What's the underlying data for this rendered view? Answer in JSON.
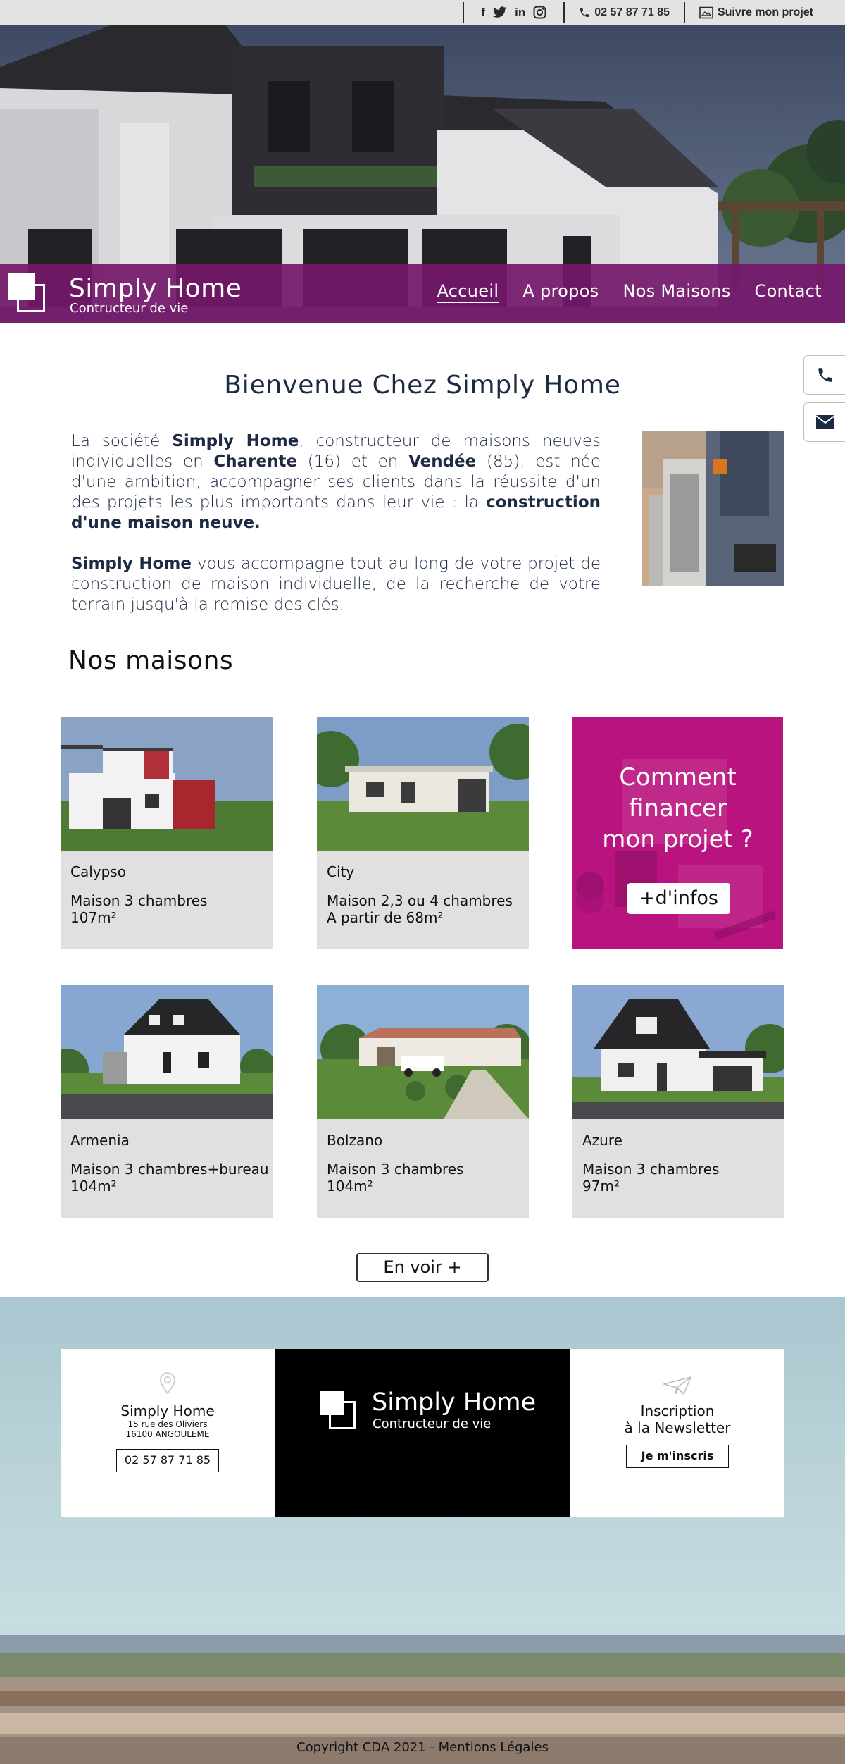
{
  "topbar": {
    "social": [
      {
        "label": "f",
        "icon": "facebook-icon"
      },
      {
        "label": "twitter",
        "icon": "twitter-icon"
      },
      {
        "label": "in",
        "icon": "linkedin-icon"
      },
      {
        "label": "instagram",
        "icon": "instagram-icon"
      }
    ],
    "phone": "02 57 87 71 85",
    "project_link": "Suivre mon projet"
  },
  "brand": {
    "name": "Simply Home",
    "tagline": "Contructeur de vie"
  },
  "nav": {
    "items": [
      "Accueil",
      "A propos",
      "Nos Maisons",
      "Contact"
    ],
    "active": "Accueil"
  },
  "side_buttons": {
    "phone_icon": "phone-icon",
    "mail_icon": "mail-icon"
  },
  "welcome": {
    "title": "Bienvenue Chez Simply Home",
    "p1": {
      "t1": "La société ",
      "b1": "Simply Home",
      "t2": ", constructeur de maisons neuves individuelles en ",
      "b2": "Charente",
      "t3": " (16) et en ",
      "b3": "Vendée",
      "t4": " (85), est née d'une ambition, accompagner ses clients dans la réussite d'un des projets les plus importants dans leur vie : la ",
      "b4": "construction d'une maison neuve."
    },
    "p2": {
      "b1": "Simply Home",
      "t1": " vous accompagne tout au long de votre projet de construction de maison individuelle, de la recherche de votre terrain jusqu'à la remise des clés."
    }
  },
  "houses": {
    "title": "Nos maisons",
    "cards": [
      {
        "name": "Calypso",
        "desc1": "Maison 3 chambres",
        "desc2": "107m²"
      },
      {
        "name": "City",
        "desc1": "Maison 2,3 ou 4 chambres",
        "desc2": "A partir de 68m²"
      },
      {
        "name": "Armenia",
        "desc1": "Maison 3 chambres+bureau",
        "desc2": "104m²"
      },
      {
        "name": "Bolzano",
        "desc1": "Maison 3 chambres",
        "desc2": "104m²"
      },
      {
        "name": "Azure",
        "desc1": "Maison 3 chambres",
        "desc2": "97m²"
      }
    ],
    "promo": {
      "line1": "Comment",
      "line2": "financer",
      "line3": "mon projet ?",
      "button": "+d'infos"
    },
    "more_button": "En voir +"
  },
  "footer": {
    "address": {
      "name": "Simply Home",
      "street": "15 rue des Oliviers",
      "city": "16100 ANGOULEME",
      "phone": "02 57 87 71 85"
    },
    "brand_name": "Simply Home",
    "brand_tagline": "Contructeur de vie",
    "newsletter": {
      "line1": "Inscription",
      "line2": "à la Newsletter",
      "button": "Je m'inscris"
    },
    "copyright": "Copyright CDA 2021 - Mentions Légales"
  },
  "colors": {
    "nav_bg": "#74186a",
    "promo_bg": "#b8137f",
    "text_dark": "#1c2a44",
    "card_bg": "#e0e0e0"
  }
}
